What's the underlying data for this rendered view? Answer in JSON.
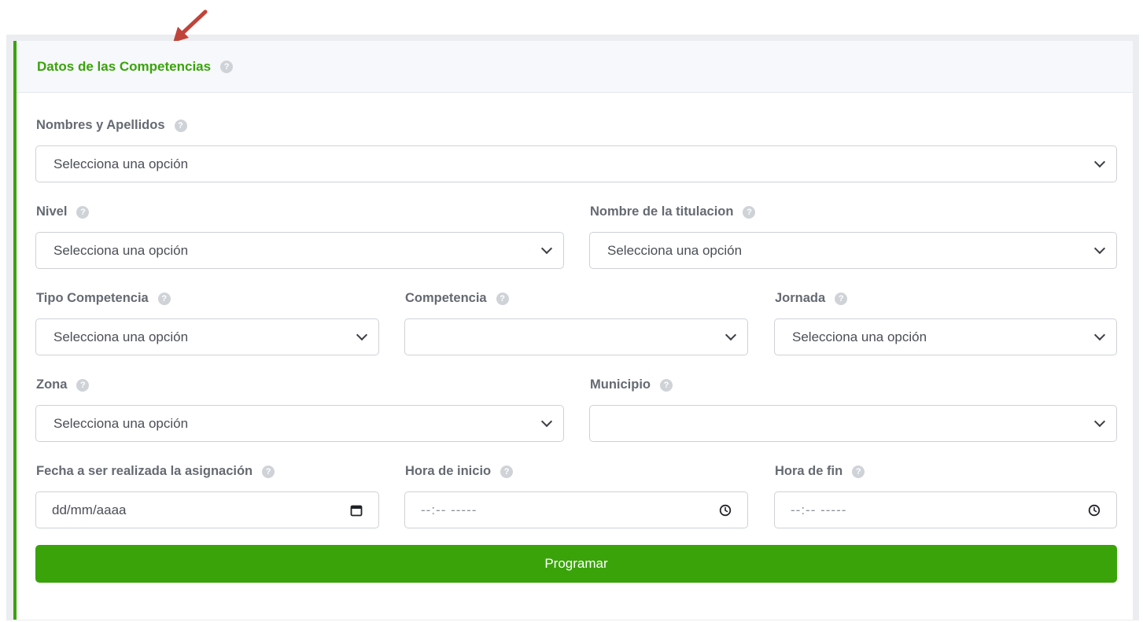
{
  "form": {
    "title": "Datos de las Competencias",
    "help_glyph": "?",
    "fields": {
      "nombres": {
        "label": "Nombres y Apellidos",
        "value": "Selecciona una opción"
      },
      "nivel": {
        "label": "Nivel",
        "value": "Selecciona una opción"
      },
      "titulacion": {
        "label": "Nombre de la titulacion",
        "value": "Selecciona una opción"
      },
      "tipo_competencia": {
        "label": "Tipo Competencia",
        "value": "Selecciona una opción"
      },
      "competencia": {
        "label": "Competencia",
        "value": ""
      },
      "jornada": {
        "label": "Jornada",
        "value": "Selecciona una opción"
      },
      "zona": {
        "label": "Zona",
        "value": "Selecciona una opción"
      },
      "municipio": {
        "label": "Municipio",
        "value": ""
      },
      "fecha": {
        "label": "Fecha a ser realizada la asignación",
        "placeholder": "dd/mm/aaaa"
      },
      "hora_inicio": {
        "label": "Hora de inicio",
        "placeholder": "--:-- -----"
      },
      "hora_fin": {
        "label": "Hora de fin",
        "placeholder": "--:-- -----"
      }
    },
    "submit_label": "Programar"
  },
  "colors": {
    "accent": "#3aa30a",
    "annotation_arrow": "#c0443a"
  },
  "icons": [
    "help-icon",
    "chevron-down-icon",
    "calendar-icon",
    "clock-icon",
    "annotation-arrow"
  ]
}
